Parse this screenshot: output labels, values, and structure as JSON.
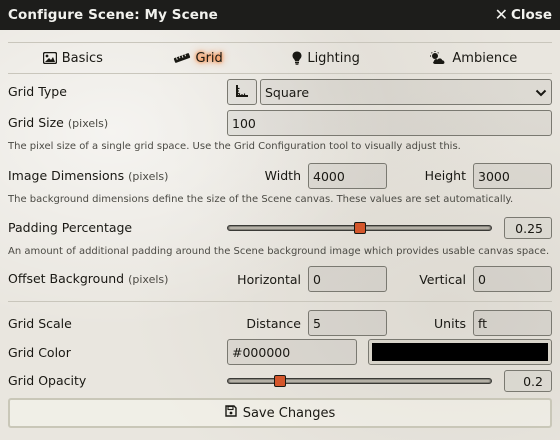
{
  "window": {
    "title": "Configure Scene: My Scene",
    "close_label": "Close"
  },
  "tabs": [
    {
      "label": "Basics",
      "icon": "image-icon",
      "active": false
    },
    {
      "label": "Grid",
      "icon": "ruler-icon",
      "active": true
    },
    {
      "label": "Lighting",
      "icon": "lightbulb-icon",
      "active": false
    },
    {
      "label": "Ambience",
      "icon": "cloud-sun-icon",
      "active": false
    }
  ],
  "grid_type": {
    "label": "Grid Type",
    "value": "Square",
    "config_icon": "grid-config-icon"
  },
  "grid_size": {
    "label": "Grid Size",
    "units": "(pixels)",
    "value": "100",
    "hint": "The pixel size of a single grid space. Use the Grid Configuration tool to visually adjust this."
  },
  "image_dimensions": {
    "label": "Image Dimensions",
    "units": "(pixels)",
    "width_label": "Width",
    "width_value": "4000",
    "height_label": "Height",
    "height_value": "3000",
    "hint": "The background dimensions define the size of the Scene canvas. These values are set automatically."
  },
  "padding": {
    "label": "Padding Percentage",
    "value": "0.25",
    "fraction": 0.25,
    "hint": "An amount of additional padding around the Scene background image which provides usable canvas space."
  },
  "offset": {
    "label": "Offset Background",
    "units": "(pixels)",
    "horizontal_label": "Horizontal",
    "horizontal_value": "0",
    "vertical_label": "Vertical",
    "vertical_value": "0"
  },
  "grid_scale": {
    "label": "Grid Scale",
    "distance_label": "Distance",
    "distance_value": "5",
    "units_label": "Units",
    "units_value": "ft"
  },
  "grid_color": {
    "label": "Grid Color",
    "value": "#000000",
    "swatch": "#000000"
  },
  "grid_opacity": {
    "label": "Grid Opacity",
    "value": "0.2",
    "fraction": 0.2
  },
  "save": {
    "label": "Save Changes",
    "icon": "save-icon"
  },
  "colors": {
    "accent": "#ff6400",
    "slider_thumb": "#d4562b",
    "titlebar": "#1d1d1b"
  }
}
